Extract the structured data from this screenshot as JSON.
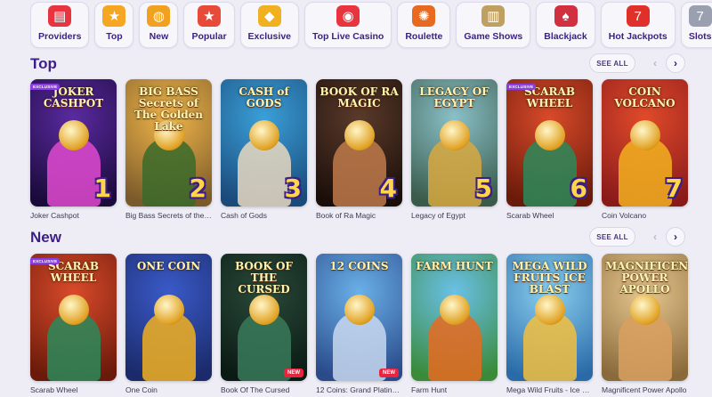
{
  "categories": [
    {
      "label": "Providers",
      "icon": "providers-icon",
      "color": "#e8343f",
      "glyph": "▤"
    },
    {
      "label": "Top",
      "icon": "medal-icon",
      "color": "#f5a623",
      "glyph": "★"
    },
    {
      "label": "New",
      "icon": "bell-icon",
      "color": "#f2a020",
      "glyph": "◍"
    },
    {
      "label": "Popular",
      "icon": "star-icon",
      "color": "#e84a3a",
      "glyph": "★"
    },
    {
      "label": "Exclusive",
      "icon": "gold-bar-icon",
      "color": "#f0b020",
      "glyph": "◆"
    },
    {
      "label": "Top Live Casino",
      "icon": "chips-icon",
      "color": "#e8343f",
      "glyph": "◉"
    },
    {
      "label": "Roulette",
      "icon": "roulette-icon",
      "color": "#e86a20",
      "glyph": "✺"
    },
    {
      "label": "Game Shows",
      "icon": "game-show-icon",
      "color": "#c0a060",
      "glyph": "▥"
    },
    {
      "label": "Blackjack",
      "icon": "cards-icon",
      "color": "#d03040",
      "glyph": "♠"
    },
    {
      "label": "Hot Jackpots",
      "icon": "jackpot-seven-icon",
      "color": "#e0302a",
      "glyph": "7"
    },
    {
      "label": "Slots",
      "icon": "slot-reels-icon",
      "color": "#9aa0b0",
      "glyph": "7"
    }
  ],
  "sections": {
    "top": {
      "title": "Top",
      "see_all": "SEE ALL",
      "games": [
        {
          "name": "Joker Cashpot",
          "art": "JOKER CASHPOT",
          "rank": "1",
          "badge": "EXCLUSIVE",
          "bg1": "#5a2aa0",
          "bg2": "#1a0a3a",
          "accent": "#e04ad0"
        },
        {
          "name": "Big Bass Secrets of the G...",
          "art": "BIG BASS Secrets of The Golden Lake",
          "rank": "2",
          "badge": "",
          "bg1": "#f2b64a",
          "bg2": "#7a5a2a",
          "accent": "#3a6a2a"
        },
        {
          "name": "Cash of Gods",
          "art": "CASH of GODS",
          "rank": "3",
          "badge": "",
          "bg1": "#3aa0d8",
          "bg2": "#1a4a7a",
          "accent": "#e8d8c0"
        },
        {
          "name": "Book of Ra Magic",
          "art": "BOOK OF RA MAGIC",
          "rank": "4",
          "badge": "",
          "bg1": "#5a3a2a",
          "bg2": "#1a0e0a",
          "accent": "#c07a4a"
        },
        {
          "name": "Legacy of Egypt",
          "art": "LEGACY OF EGYPT",
          "rank": "5",
          "badge": "",
          "bg1": "#8ac0c8",
          "bg2": "#3a5a4a",
          "accent": "#d8a840"
        },
        {
          "name": "Scarab Wheel",
          "art": "SCARAB WHEEL",
          "rank": "6",
          "badge": "EXCLUSIVE",
          "bg1": "#d84a2a",
          "bg2": "#6a1a0a",
          "accent": "#2a8a5a"
        },
        {
          "name": "Coin Volcano",
          "art": "COIN VOLCANO",
          "rank": "7",
          "badge": "",
          "bg1": "#e04a2a",
          "bg2": "#8a1a1a",
          "accent": "#f2b020"
        }
      ]
    },
    "new": {
      "title": "New",
      "see_all": "SEE ALL",
      "games": [
        {
          "name": "Scarab Wheel",
          "art": "SCARAB WHEEL",
          "badge": "EXCLUSIVE",
          "is_new": false,
          "bg1": "#d84a2a",
          "bg2": "#6a1a0a",
          "accent": "#2a8a5a"
        },
        {
          "name": "One Coin",
          "art": "ONE COIN",
          "badge": "",
          "is_new": false,
          "bg1": "#3a5ac8",
          "bg2": "#1a2a6a",
          "accent": "#f2b020"
        },
        {
          "name": "Book Of The Cursed",
          "art": "BOOK OF THE CURSED",
          "badge": "",
          "is_new": true,
          "bg1": "#2a4a3a",
          "bg2": "#0a1a14",
          "accent": "#3a7a5a"
        },
        {
          "name": "12 Coins: Grand Platinum...",
          "art": "12 COINS",
          "badge": "",
          "is_new": true,
          "bg1": "#6ab0e8",
          "bg2": "#2a4a8a",
          "accent": "#c8d8f0"
        },
        {
          "name": "Farm Hunt",
          "art": "FARM HUNT",
          "badge": "",
          "is_new": false,
          "bg1": "#6ac0e8",
          "bg2": "#3a8a3a",
          "accent": "#e86a20"
        },
        {
          "name": "Mega Wild Fruits - Ice Bl...",
          "art": "MEGA WILD FRUITS ICE BLAST",
          "badge": "",
          "is_new": false,
          "bg1": "#8ad0f0",
          "bg2": "#2a6aa8",
          "accent": "#f2c040"
        },
        {
          "name": "Magnificent Power Apollo",
          "art": "MAGNIFICENT POWER APOLLO",
          "badge": "",
          "is_new": false,
          "bg1": "#e8c890",
          "bg2": "#8a6a3a",
          "accent": "#d8a060"
        }
      ]
    }
  },
  "labels": {
    "new_badge": "NEW",
    "prev": "‹",
    "next": "›"
  }
}
